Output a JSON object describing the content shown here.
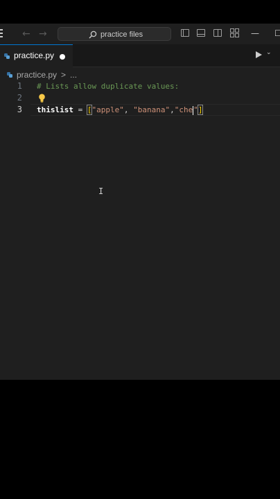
{
  "titlebar": {
    "search_text": "practice files",
    "back_arrow": "←",
    "forward_arrow": "→",
    "minimize_glyph": "—",
    "maximize_glyph": "☐"
  },
  "tab": {
    "filename": "practice.py",
    "dirty": true
  },
  "breadcrumb": {
    "file": "practice.py",
    "separator": ">",
    "more": "..."
  },
  "editor": {
    "lines": [
      {
        "number": "1",
        "comment": "# Lists allow duplicate values:"
      },
      {
        "number": "2"
      },
      {
        "number": "3",
        "var": "thislist",
        "eq": " = ",
        "open": "[",
        "s1": "\"apple\"",
        "sep1": ", ",
        "s2": "\"banana\"",
        "sep2": ",",
        "s3": "\"che",
        "s3_end": "\"",
        "close": "]"
      }
    ],
    "cursor_glyph": "I"
  },
  "colors": {
    "editor_bg": "#1f1f1f",
    "comment": "#6a9955",
    "string": "#ce9178",
    "bracket": "#ffd700",
    "accent": "#0078d4"
  }
}
